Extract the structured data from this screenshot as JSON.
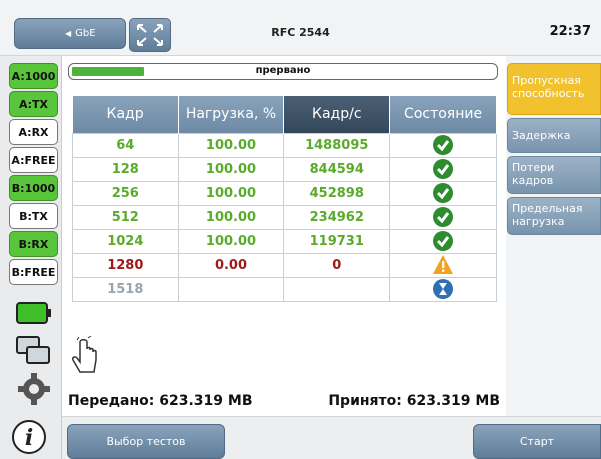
{
  "header": {
    "back_label": "GbE",
    "title": "RFC 2544",
    "clock": "22:37"
  },
  "ports": [
    {
      "label": "A:1000",
      "style": "green"
    },
    {
      "label": "A:TX",
      "style": "green"
    },
    {
      "label": "A:RX",
      "style": "white"
    },
    {
      "label": "A:FREE",
      "style": "white"
    },
    {
      "label": "B:1000",
      "style": "green"
    },
    {
      "label": "B:TX",
      "style": "white"
    },
    {
      "label": "B:RX",
      "style": "green"
    },
    {
      "label": "B:FREE",
      "style": "white"
    }
  ],
  "progress": {
    "label": "прервано",
    "fraction": 0.17,
    "color": "#4db33a"
  },
  "table": {
    "headers": [
      "Кадр",
      "Нагрузка, %",
      "Кадр/с",
      "Состояние"
    ],
    "active_header": 2,
    "rows": [
      {
        "frame": "64",
        "load": "100.00",
        "fps": "1488095",
        "state": "ok"
      },
      {
        "frame": "128",
        "load": "100.00",
        "fps": "844594",
        "state": "ok"
      },
      {
        "frame": "256",
        "load": "100.00",
        "fps": "452898",
        "state": "ok"
      },
      {
        "frame": "512",
        "load": "100.00",
        "fps": "234962",
        "state": "ok"
      },
      {
        "frame": "1024",
        "load": "100.00",
        "fps": "119731",
        "state": "ok"
      },
      {
        "frame": "1280",
        "load": "0.00",
        "fps": "0",
        "state": "fail"
      },
      {
        "frame": "1518",
        "load": "",
        "fps": "",
        "state": "pending"
      }
    ]
  },
  "totals": {
    "sent": "Передано: 623.319 MB",
    "received": "Принято: 623.319 MB"
  },
  "side_tabs": [
    {
      "label": "Пропускная способность",
      "active": true
    },
    {
      "label": "Задержка",
      "active": false
    },
    {
      "label": "Потери кадров",
      "active": false
    },
    {
      "label": "Предельная нагрузка",
      "active": false
    }
  ],
  "footer": {
    "tests_label": "Выбор тестов",
    "start_label": "Старт"
  },
  "colors": {
    "accent": "#f2c12e",
    "ok": "#5aaa2b",
    "fail": "#a11a1a",
    "button": "#6f8ca7"
  },
  "icons": [
    "fullscreen-icon",
    "battery-icon",
    "screens-icon",
    "gear-icon",
    "info-icon",
    "touch-hand-icon"
  ]
}
